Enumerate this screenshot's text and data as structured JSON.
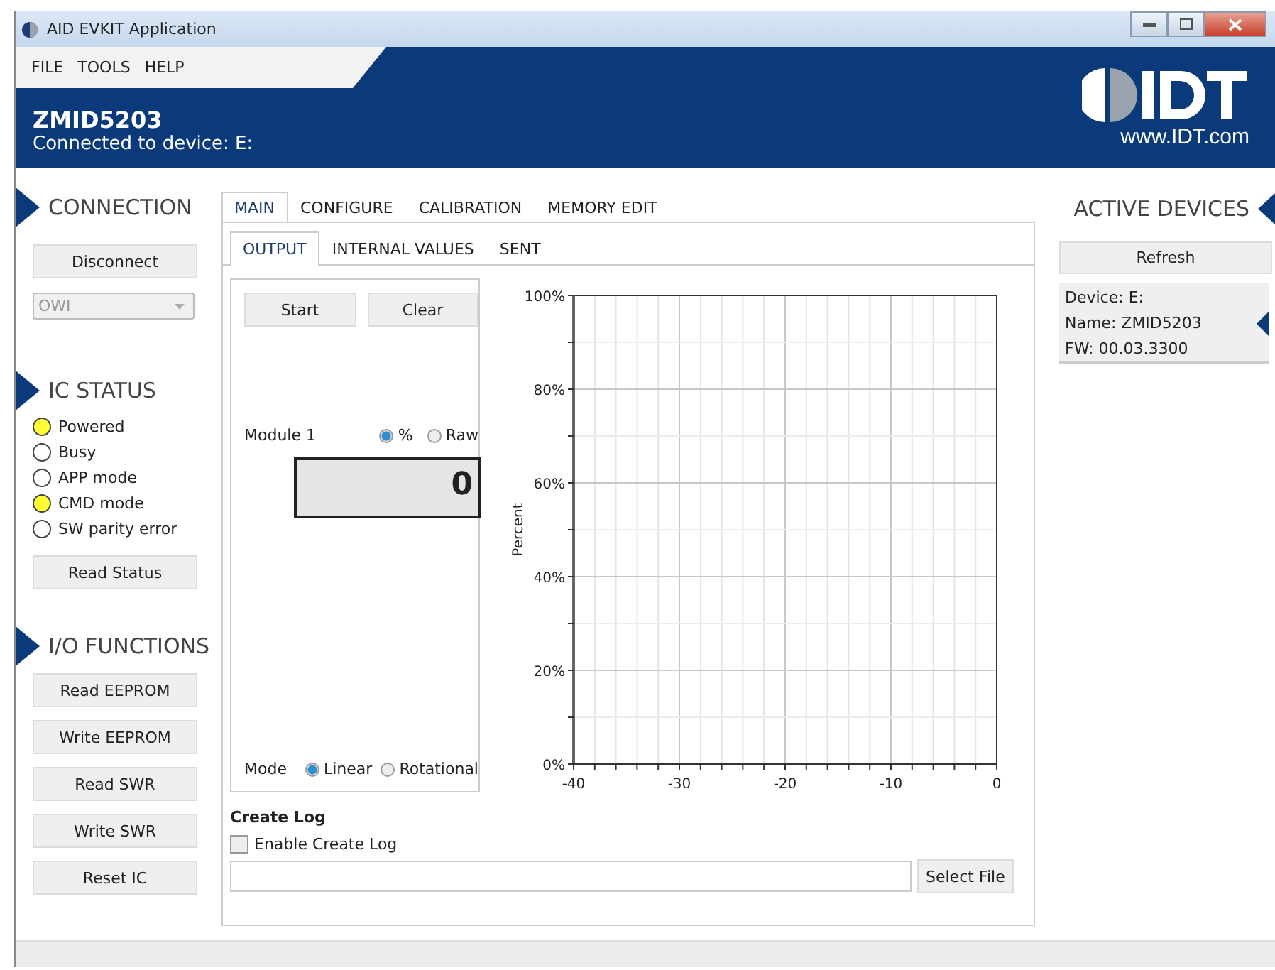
{
  "window": {
    "title": "AID EVKIT Application"
  },
  "menu": [
    "FILE",
    "TOOLS",
    "HELP"
  ],
  "header": {
    "device": "ZMID5203",
    "connection": "Connected to device: E:",
    "website": "www.IDT.com"
  },
  "connection": {
    "title": "CONNECTION",
    "button": "Disconnect",
    "interface": "OWI"
  },
  "ic_status": {
    "title": "IC STATUS",
    "items": [
      {
        "label": "Powered",
        "on": true
      },
      {
        "label": "Busy",
        "on": false
      },
      {
        "label": "APP mode",
        "on": false
      },
      {
        "label": "CMD mode",
        "on": true
      },
      {
        "label": "SW parity error",
        "on": false
      }
    ],
    "button": "Read Status"
  },
  "io_functions": {
    "title": "I/O FUNCTIONS",
    "buttons": [
      "Read EEPROM",
      "Write EEPROM",
      "Read SWR",
      "Write SWR",
      "Reset IC"
    ]
  },
  "tabs": [
    {
      "label": "MAIN",
      "selected": true
    },
    {
      "label": "CONFIGURE",
      "selected": false
    },
    {
      "label": "CALIBRATION",
      "selected": false
    },
    {
      "label": "MEMORY EDIT",
      "selected": false
    }
  ],
  "subtabs": [
    {
      "label": "OUTPUT",
      "selected": true
    },
    {
      "label": "INTERNAL VALUES",
      "selected": false
    },
    {
      "label": "SENT",
      "selected": false
    }
  ],
  "output": {
    "buttons": [
      "Start",
      "Clear"
    ],
    "module_label": "Module 1",
    "units": [
      {
        "label": "%",
        "selected": true
      },
      {
        "label": "Raw",
        "selected": false
      }
    ],
    "value": "0",
    "mode_label": "Mode",
    "modes": [
      {
        "label": "Linear",
        "selected": true
      },
      {
        "label": "Rotational",
        "selected": false
      }
    ],
    "chart_data": {
      "type": "line",
      "grid": true,
      "ylabel": "Percent",
      "xlim": [
        -40,
        0
      ],
      "ylim": [
        0,
        100
      ],
      "xticks": [
        -40,
        -30,
        -20,
        -10,
        0
      ],
      "yticks": [
        {
          "value": 0,
          "label": "0%"
        },
        {
          "value": 20,
          "label": "20%"
        },
        {
          "value": 40,
          "label": "40%"
        },
        {
          "value": 60,
          "label": "60%"
        },
        {
          "value": 80,
          "label": "80%"
        },
        {
          "value": 100,
          "label": "100%"
        }
      ]
    }
  },
  "create_log": {
    "title": "Create Log",
    "checkbox": {
      "label": "Enable Create Log",
      "checked": false
    },
    "button": "Select File"
  },
  "active_devices": {
    "title": "ACTIVE DEVICES",
    "button": "Refresh",
    "device": [
      "Device: E:",
      "Name: ZMID5203",
      "FW: 00.03.3300"
    ]
  }
}
